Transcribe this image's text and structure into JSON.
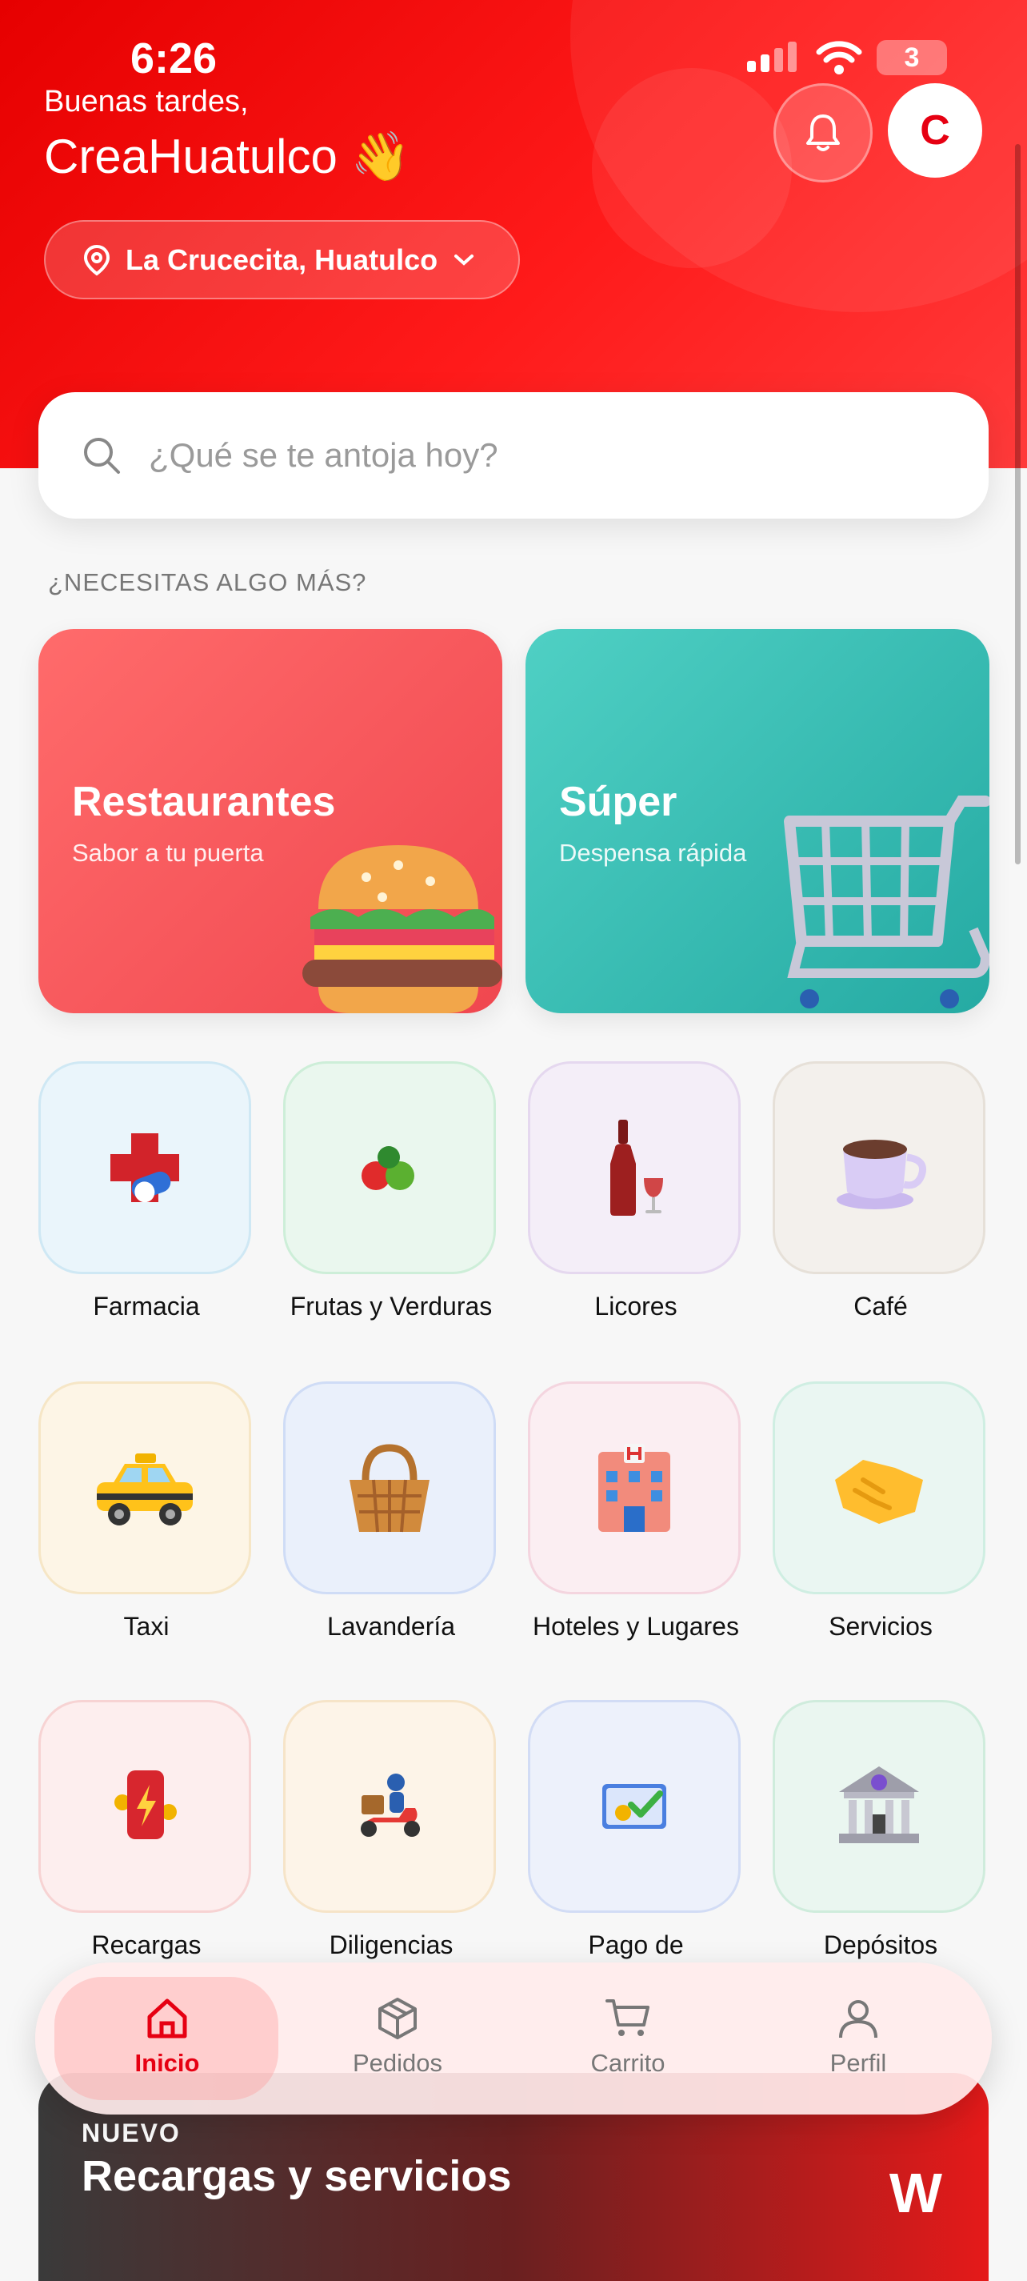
{
  "status": {
    "time": "6:26",
    "battery": "3"
  },
  "header": {
    "greeting": "Buenas tardes,",
    "user_name": "CreaHuatulco 👋",
    "avatar_initial": "C",
    "location": "La Crucecita, Huatulco"
  },
  "search": {
    "placeholder": "¿Qué se te antoja hoy?"
  },
  "section_title": "¿NECESITAS ALGO MÁS?",
  "featured": [
    {
      "title": "Restaurantes",
      "subtitle": "Sabor a tu puerta"
    },
    {
      "title": "Súper",
      "subtitle": "Despensa rápida"
    }
  ],
  "categories": [
    {
      "label": "Farmacia",
      "emoji": "💊"
    },
    {
      "label": "Frutas y Verduras",
      "emoji": "🍒"
    },
    {
      "label": "Licores",
      "emoji": "🍷"
    },
    {
      "label": "Café",
      "emoji": "☕"
    },
    {
      "label": "Taxi",
      "emoji": "🚕"
    },
    {
      "label": "Lavandería",
      "emoji": "🧺"
    },
    {
      "label": "Hoteles y Lugares",
      "emoji": "🏨"
    },
    {
      "label": "Servicios",
      "emoji": "🤝"
    },
    {
      "label": "Recargas",
      "emoji": "📱"
    },
    {
      "label": "Diligencias",
      "emoji": "🛵"
    },
    {
      "label": "Pago de",
      "emoji": "💳"
    },
    {
      "label": "Depósitos",
      "emoji": "🏛"
    }
  ],
  "nav": {
    "home": "Inicio",
    "orders": "Pedidos",
    "cart": "Carrito",
    "profile": "Perfil"
  },
  "promo": {
    "kicker": "NUEVO",
    "title": "Recargas y servicios",
    "logo": "W"
  },
  "colors": {
    "brand": "#e60012",
    "text": "#111111"
  }
}
